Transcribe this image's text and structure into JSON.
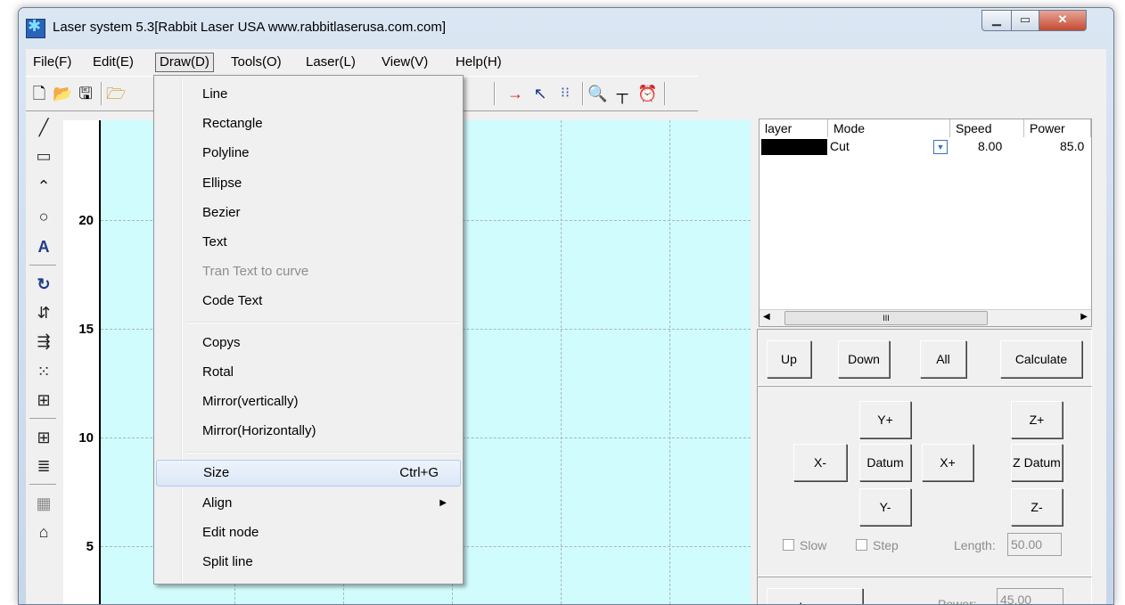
{
  "window": {
    "title": "Laser system 5.3[Rabbit Laser USA www.rabbitlaserusa.com.com]"
  },
  "menubar": [
    "File(F)",
    "Edit(E)",
    "Draw(D)",
    "Tools(O)",
    "Laser(L)",
    "View(V)",
    "Help(H)"
  ],
  "toolbar_icons": [
    "new-file-icon",
    "open-folder-icon",
    "save-icon",
    "import-icon",
    "laser-path-icon",
    "node-cursor-icon",
    "array-icon",
    "print-preview-icon",
    "ruler-icon",
    "timer-icon"
  ],
  "left_tools": [
    "line-tool-icon",
    "rectangle-tool-icon",
    "polyline-tool-icon",
    "ellipse-tool-icon",
    "text-tool-icon",
    "rotate-icon",
    "mirror-icon",
    "align-icon",
    "nodes-icon",
    "size-icon",
    "array-grid-icon",
    "distribute-icon",
    "hatch-icon",
    "cake-icon"
  ],
  "ruler": {
    "labels": [
      "20",
      "15",
      "10",
      "5"
    ]
  },
  "draw_menu": {
    "items": [
      {
        "label": "Line"
      },
      {
        "label": "Rectangle"
      },
      {
        "label": "Polyline"
      },
      {
        "label": "Ellipse"
      },
      {
        "label": "Bezier"
      },
      {
        "label": "Text"
      },
      {
        "label": "Tran Text to curve",
        "disabled": true
      },
      {
        "label": "Code Text"
      },
      {
        "label": "Copys"
      },
      {
        "label": "Rotal"
      },
      {
        "label": "Mirror(vertically)"
      },
      {
        "label": "Mirror(Horizontally)"
      },
      {
        "label": "Size",
        "shortcut": "Ctrl+G",
        "highlighted": true
      },
      {
        "label": "Align",
        "submenu": true
      },
      {
        "label": "Edit node"
      },
      {
        "label": "Split line"
      }
    ]
  },
  "layers": {
    "headers": [
      "layer",
      "Mode",
      "Speed",
      "Power"
    ],
    "rows": [
      {
        "color": "#000000",
        "mode": "Cut",
        "speed": "8.00",
        "power": "85.0"
      }
    ],
    "scroll_glyph": "III"
  },
  "layer_buttons": [
    "Up",
    "Down",
    "All",
    "Calculate"
  ],
  "motion_buttons": {
    "y_plus": "Y+",
    "z_plus": "Z+",
    "x_minus": "X-",
    "datum": "Datum",
    "x_plus": "X+",
    "z_datum": "Z Datum",
    "y_minus": "Y-",
    "z_minus": "Z-"
  },
  "options": {
    "slow": "Slow",
    "step": "Step",
    "length_label": "Length:",
    "length_value": "50.00"
  },
  "laser": {
    "button": "Laser",
    "power_label": "Power:",
    "power_value": "45.00"
  }
}
